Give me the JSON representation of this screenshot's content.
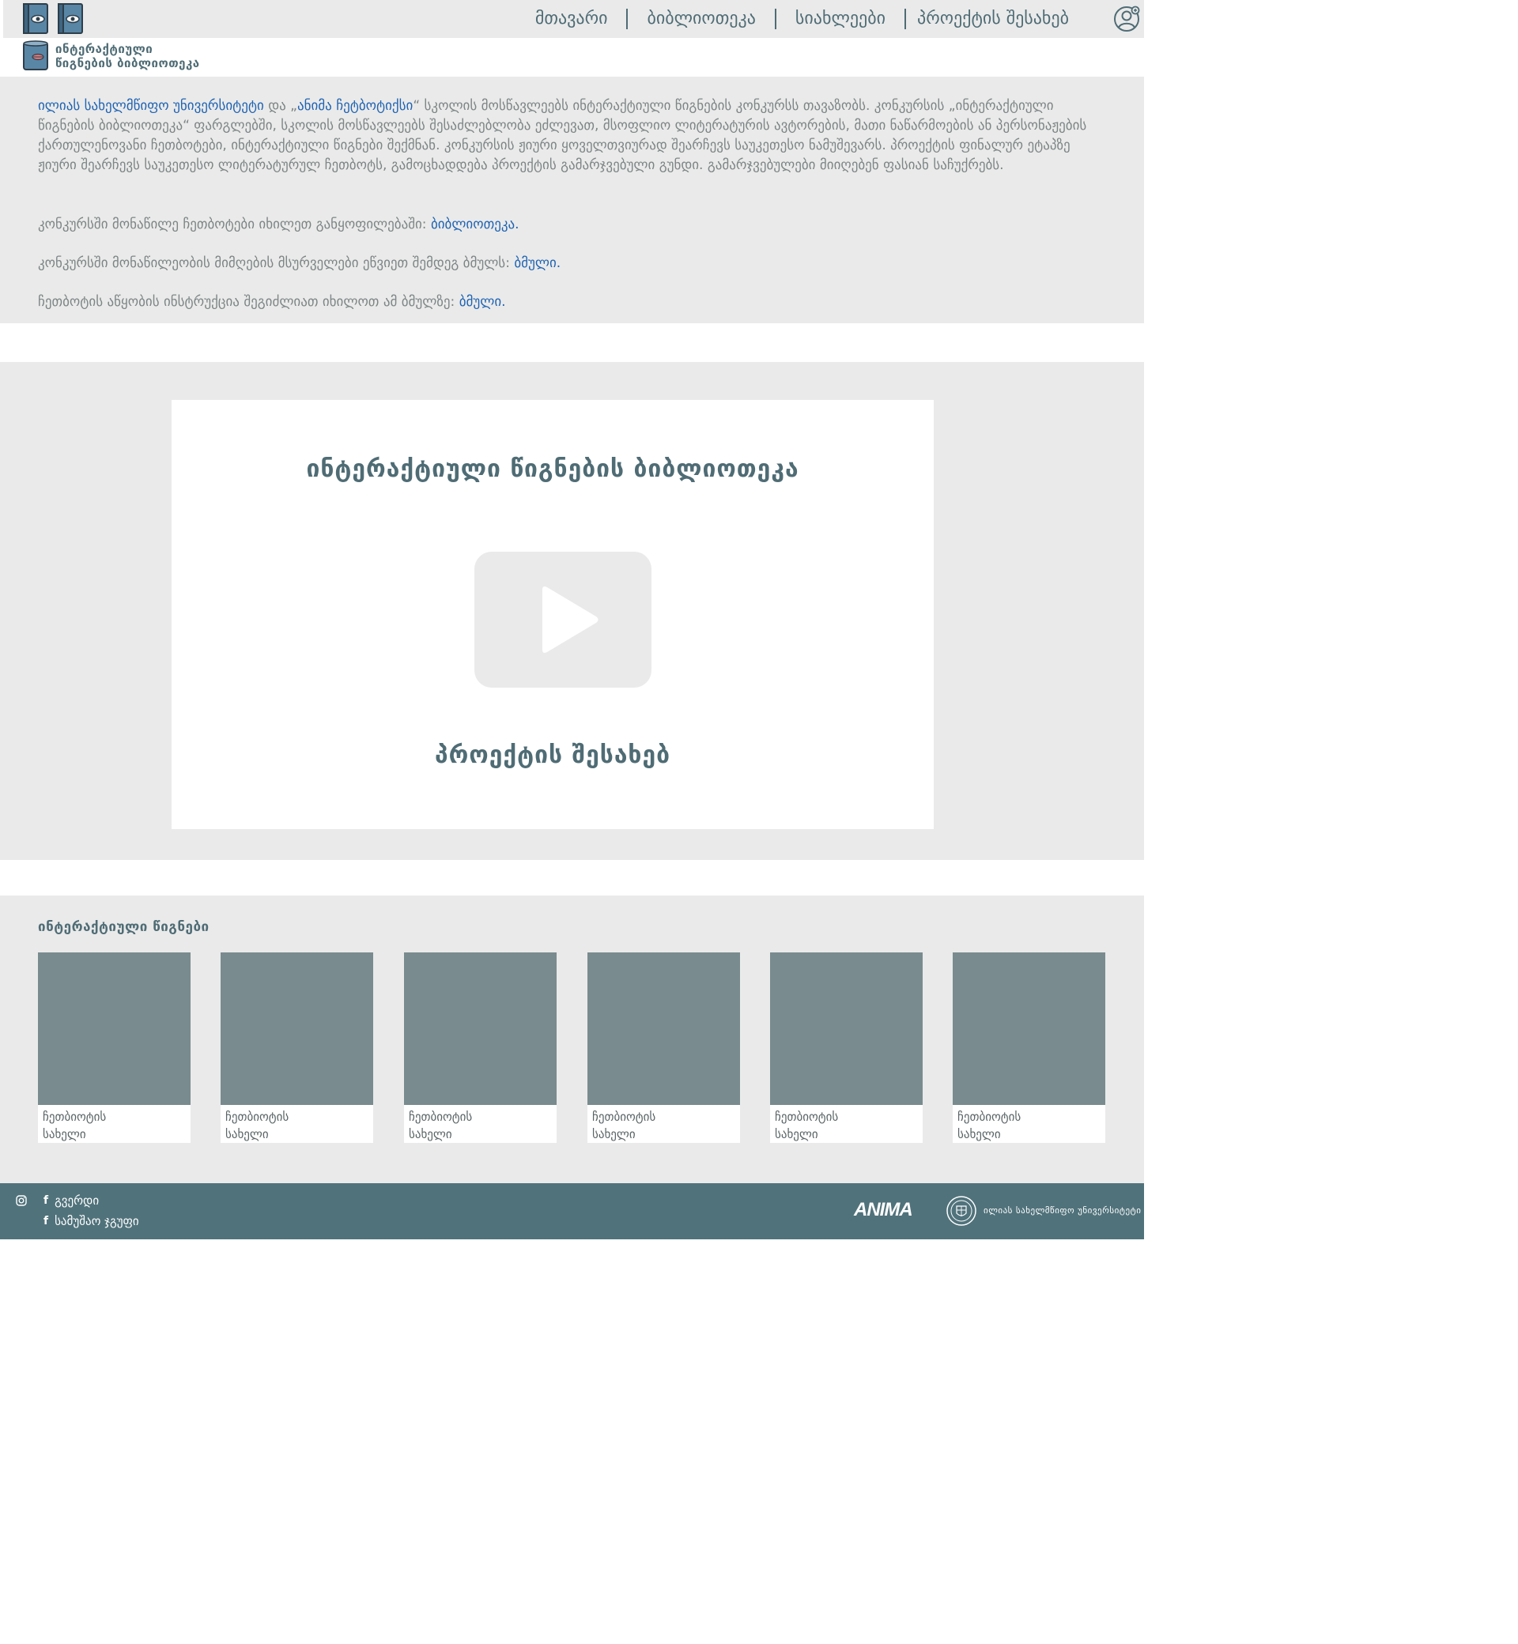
{
  "header": {
    "nav": [
      "მთავარი",
      "ბიბლიოთეკა",
      "სიახლეები",
      "პროექტის შესახებ"
    ],
    "brand_line1": "ინტერაქტიული",
    "brand_line2": "წიგნების ბიბლიოთეკა"
  },
  "intro": {
    "p1_link1": "ილიას სახელმწიფო უნივერსიტეტი",
    "p1_and": " და „",
    "p1_link2": "ანიმა ჩეტბოტიქსი",
    "p1_rest": "“ სკოლის მოსწავლეებს ინტერაქტიული წიგნების კონკურსს თავაზობს. კონკურსის „ინტერაქტიული წიგნების ბიბლიოთეკა“ ფარგლებში, სკოლის მოსწავლეებს შესაძლებლობა ეძლევათ, მსოფლიო ლიტერატურის ავტორების, მათი ნაწარმოების ან პერსონაჟების ქართულენოვანი ჩეთბოტები, ინტერაქტიული წიგნები შექმნან. კონკურსის ჟიური ყოველთვიურად შეარჩევს საუკეთესო ნამუშევარს. პროექტის ფინალურ ეტაპზე ჟიური შეარჩევს საუკეთესო ლიტერატურულ ჩეთბოტს, გამოცხადდება პროექტის გამარჯვებული გუნდი. გამარჯვებულები მიიღებენ ფასიან საჩუქრებს.",
    "p2_text": "კონკურსში მონაწილე ჩეთბოტები იხილეთ განყოფილებაში: ",
    "p2_link": "ბიბლიოთეკა.",
    "p3_text": "კონკურსში მონაწილეობის მიმღების მსურველები ეწვიეთ შემდეგ ბმულს: ",
    "p3_link": "ბმული.",
    "p4_text": "ჩეთბოტის აწყობის ინსტრუქცია შეგიძლიათ იხილოთ ამ ბმულზე: ",
    "p4_link": "ბმული."
  },
  "video": {
    "title": "ინტერაქტიული წიგნების ბიბლიოთეკა",
    "subtitle": "პროექტის შესახებ"
  },
  "books": {
    "title": "ინტერაქტიული წიგნები",
    "items": [
      "ჩეთბიოტის\nსახელი",
      "ჩეთბიოტის\nსახელი",
      "ჩეთბიოტის\nსახელი",
      "ჩეთბიოტის\nსახელი",
      "ჩეთბიოტის\nსახელი",
      "ჩეთბიოტის\nსახელი"
    ]
  },
  "footer": {
    "link1": "გვერდი",
    "link2": "სამუშაო ჯგუფი",
    "anima_logo": "ANIMA",
    "university": "ილიას სახელმწიფო უნივერსიტეტი"
  },
  "colors": {
    "accent": "#4f6c75",
    "link": "#1f63b3",
    "panel": "#eaeaea",
    "cover": "#798b8f",
    "footer": "#50727b"
  }
}
